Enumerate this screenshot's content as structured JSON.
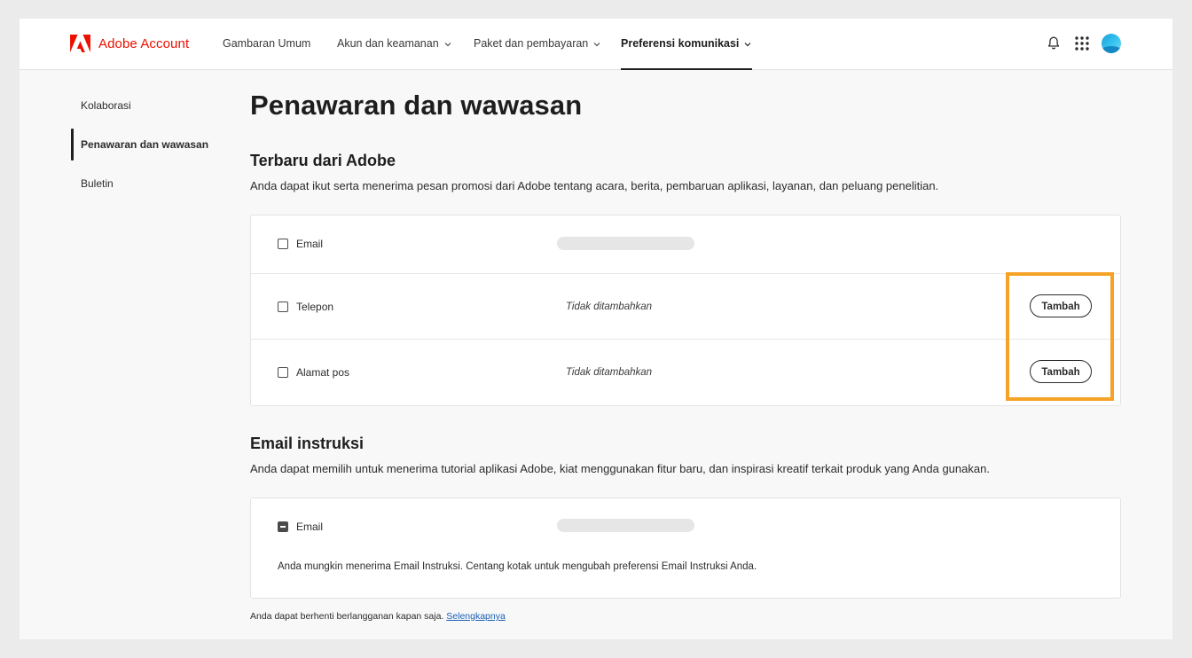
{
  "app": {
    "brand": "Adobe Account",
    "brand_color": "#eb1000"
  },
  "nav": {
    "items": [
      {
        "label": "Gambaran Umum",
        "has_dropdown": false,
        "active": false
      },
      {
        "label": "Akun dan keamanan",
        "has_dropdown": true,
        "active": false
      },
      {
        "label": "Paket dan pembayaran",
        "has_dropdown": true,
        "active": false
      },
      {
        "label": "Preferensi komunikasi",
        "has_dropdown": true,
        "active": true
      }
    ],
    "icons": [
      "bell-icon",
      "app-grid-icon",
      "avatar"
    ]
  },
  "sidebar": {
    "items": [
      {
        "label": "Kolaborasi",
        "active": false
      },
      {
        "label": "Penawaran dan wawasan",
        "active": true
      },
      {
        "label": "Buletin",
        "active": false
      }
    ]
  },
  "main": {
    "title": "Penawaran dan wawasan",
    "section1": {
      "heading": "Terbaru dari Adobe",
      "description": "Anda dapat ikut serta menerima pesan promosi dari Adobe tentang acara, berita, pembaruan aplikasi, layanan, dan peluang penelitian.",
      "rows": [
        {
          "label": "Email",
          "checked": false,
          "value_redacted": true
        },
        {
          "label": "Telepon",
          "checked": false,
          "status": "Tidak ditambahkan",
          "button": "Tambah"
        },
        {
          "label": "Alamat pos",
          "checked": false,
          "status": "Tidak ditambahkan",
          "button": "Tambah"
        }
      ]
    },
    "section2": {
      "heading": "Email instruksi",
      "description": "Anda dapat memilih untuk menerima tutorial aplikasi Adobe, kiat menggunakan fitur baru, dan inspirasi kreatif terkait produk yang Anda gunakan.",
      "rows": [
        {
          "label": "Email",
          "checked": "indeterminate",
          "value_redacted": true
        }
      ],
      "note": "Anda mungkin menerima Email Instruksi. Centang kotak untuk mengubah preferensi Email Instruksi Anda."
    },
    "footer": {
      "text": "Anda dapat berhenti berlangganan kapan saja.",
      "link": "Selengkapnya"
    }
  },
  "highlight_color": "#f5a227"
}
